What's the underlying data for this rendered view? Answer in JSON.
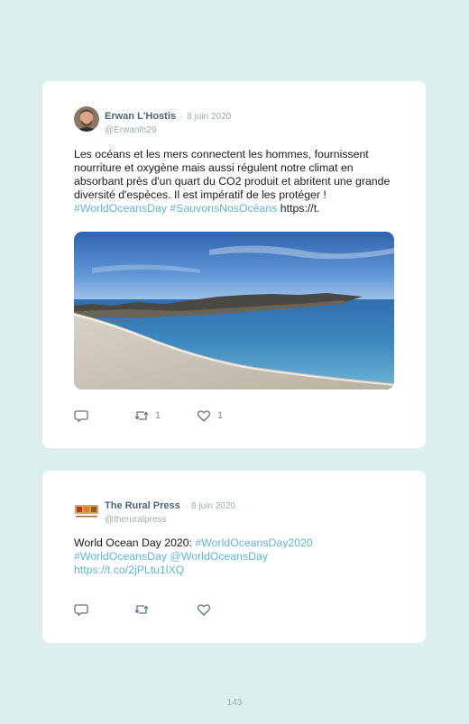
{
  "tweets": [
    {
      "name": "Erwan L'Hostis",
      "separator": "·",
      "date": "8 juin 2020",
      "handle": "@Erwanlh29",
      "text": "Les océans et les mers connectent les hommes, fournissent nourriture et oxygène mais aussi régulent notre climat en absorbant près d'un quart du CO2 produit et abritent une grande diversité d'espèces. Il est impératif de les protéger !",
      "hashtag1": "#WorldOceansDay",
      "hashtag2": "#SauvonsNosOcéans",
      "url": "https://t.",
      "retweets": "1",
      "likes": "1"
    },
    {
      "name": "The Rural Press",
      "separator": "·",
      "date": "8 juin 2020",
      "handle": "@theruralpress",
      "text": "World Ocean Day 2020:",
      "hashtag1": "#WorldOceansDay2020",
      "hashtag2": "#WorldOceansDay",
      "mention": "@WorldOceansDay",
      "url": "https://t.co/2jPLtu1lXQ",
      "retweets": "",
      "likes": ""
    }
  ],
  "page_number": "143",
  "colors": {
    "link": "#5fb6d6",
    "background": "#dceeed"
  },
  "icons": [
    "reply-icon",
    "retweet-icon",
    "heart-icon"
  ]
}
